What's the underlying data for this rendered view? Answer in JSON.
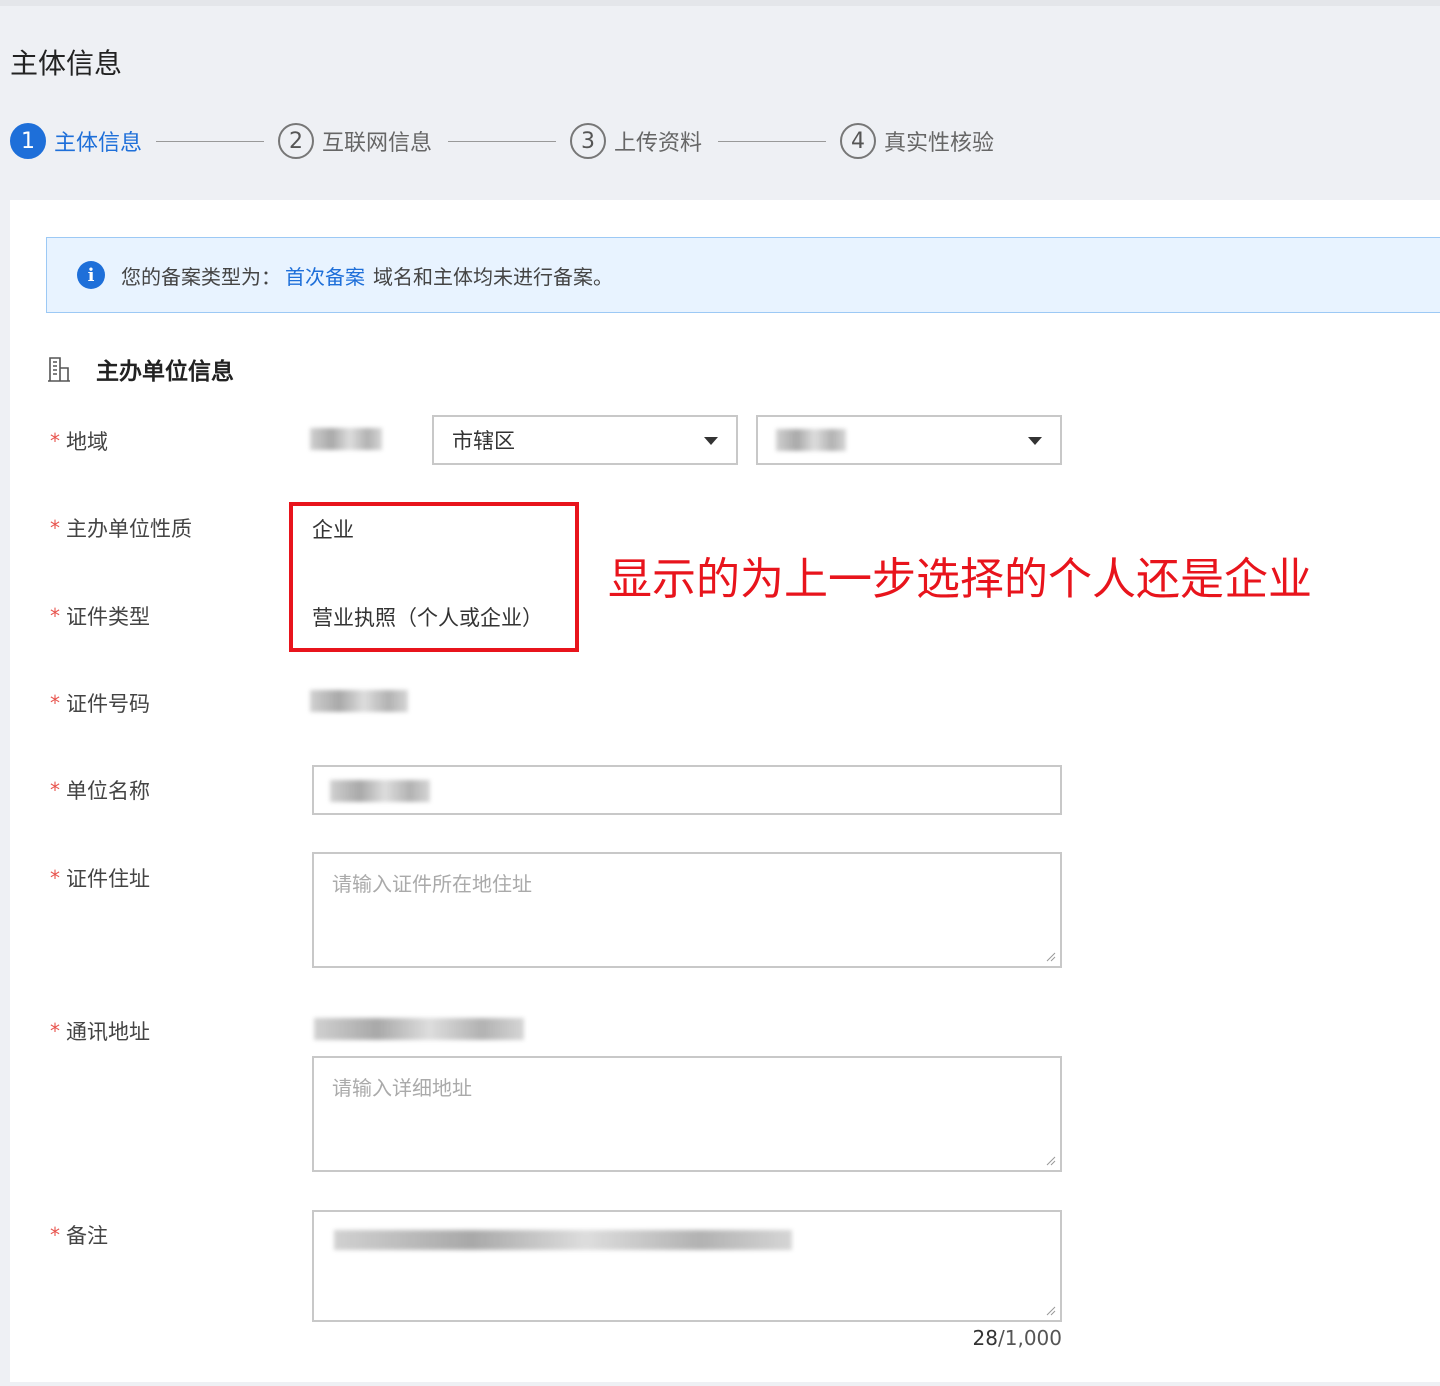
{
  "page_title": "主体信息",
  "steps": [
    {
      "num": "1",
      "label": "主体信息",
      "active": true
    },
    {
      "num": "2",
      "label": "互联网信息",
      "active": false
    },
    {
      "num": "3",
      "label": "上传资料",
      "active": false
    },
    {
      "num": "4",
      "label": "真实性核验",
      "active": false
    }
  ],
  "notice": {
    "icon": "info-icon",
    "prefix": "您的备案类型为：",
    "type": "首次备案",
    "desc": "域名和主体均未进行备案。"
  },
  "section": {
    "icon": "building-icon",
    "title": "主办单位信息"
  },
  "form": {
    "required_mark": "*",
    "region": {
      "label": "地域",
      "district": "市辖区"
    },
    "org_nature": {
      "label": "主办单位性质",
      "value": "企业"
    },
    "cert_type": {
      "label": "证件类型",
      "value": "营业执照（个人或企业）"
    },
    "cert_number": {
      "label": "证件号码"
    },
    "org_name": {
      "label": "单位名称"
    },
    "cert_address": {
      "label": "证件住址",
      "placeholder": "请输入证件所在地住址"
    },
    "mail_address": {
      "label": "通讯地址",
      "placeholder": "请输入详细地址"
    },
    "remark": {
      "label": "备注",
      "count_current": "28",
      "count_max": "/1,000"
    }
  },
  "annotation": "显示的为上一步选择的个人还是企业",
  "colors": {
    "primary": "#1e6fd9",
    "required": "#e8544e",
    "annotation_red": "#e8141c",
    "notice_bg": "#e8f3ff"
  }
}
